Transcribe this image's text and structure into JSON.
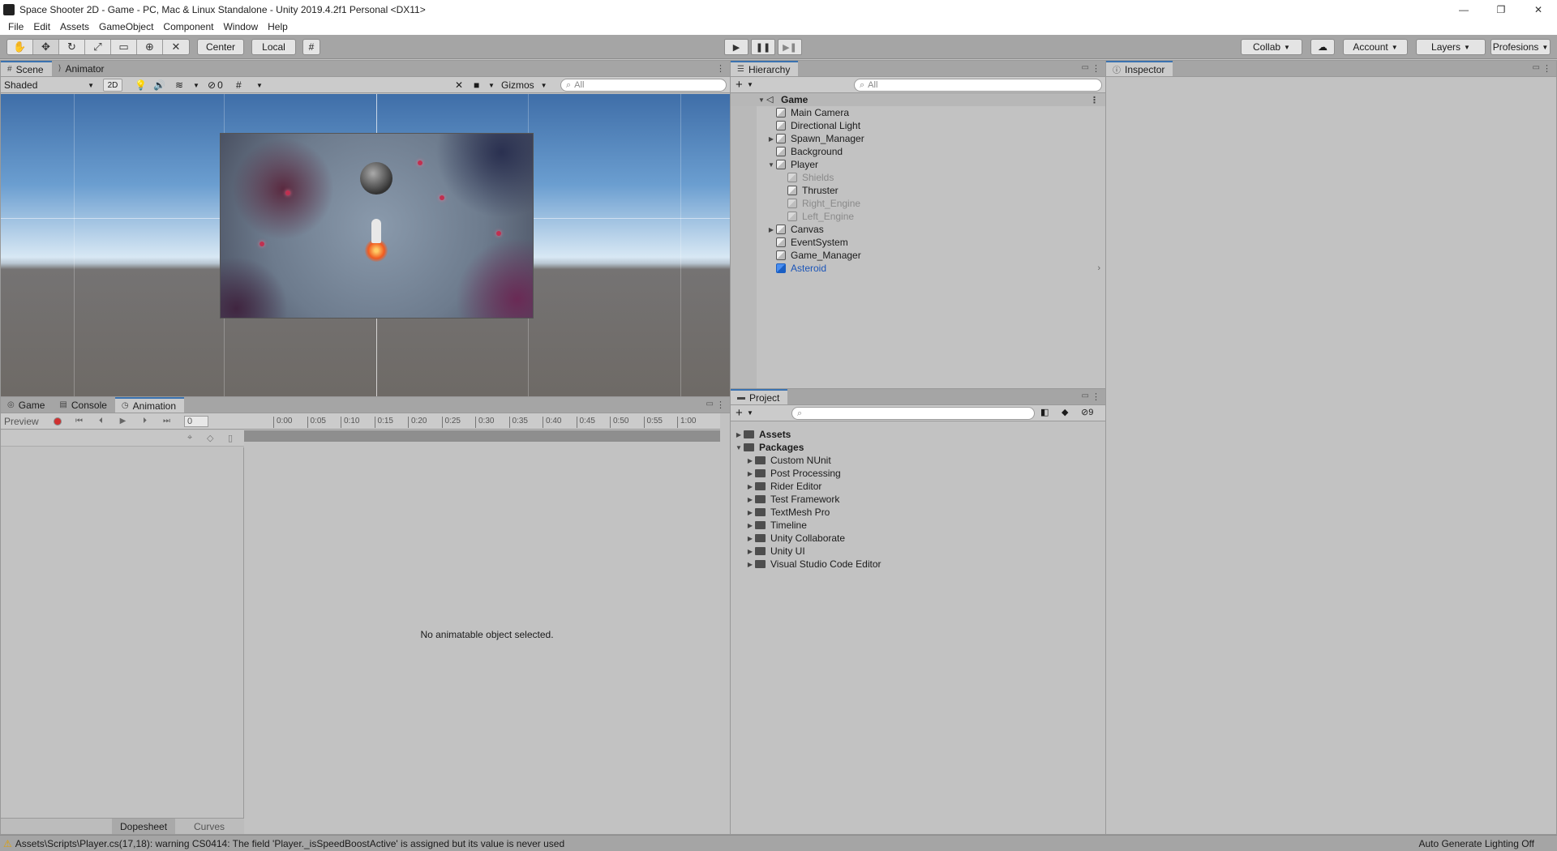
{
  "window": {
    "title": "Space Shooter 2D - Game - PC, Mac & Linux Standalone - Unity 2019.4.2f1 Personal <DX11>",
    "controls": [
      "—",
      "❐",
      "✕"
    ]
  },
  "menu": [
    "File",
    "Edit",
    "Assets",
    "GameObject",
    "Component",
    "Window",
    "Help"
  ],
  "toolbar": {
    "pivot_label": "Center",
    "space_label": "Local",
    "collab_label": "Collab",
    "account_label": "Account",
    "layers_label": "Layers",
    "layout_label": "Profesions"
  },
  "scene_panel": {
    "tabs": [
      "Scene",
      "Animator"
    ],
    "shading_mode": "Shaded",
    "mode_2d": "2D",
    "hidden_count": "0",
    "gizmos_label": "Gizmos",
    "search_placeholder": "All"
  },
  "animation_panel": {
    "tabs": [
      "Game",
      "Console",
      "Animation"
    ],
    "preview_label": "Preview",
    "frame_value": "0",
    "ruler_ticks": [
      "0:00",
      "0:05",
      "0:10",
      "0:15",
      "0:20",
      "0:25",
      "0:30",
      "0:35",
      "0:40",
      "0:45",
      "0:50",
      "0:55",
      "1:00"
    ],
    "message": "No animatable object selected.",
    "bottom_tabs": [
      "Dopesheet",
      "Curves"
    ]
  },
  "hierarchy": {
    "tab": "Hierarchy",
    "search_placeholder": "All",
    "scene_name": "Game",
    "items": [
      {
        "label": "Main Camera"
      },
      {
        "label": "Directional Light"
      },
      {
        "label": "Spawn_Manager"
      },
      {
        "label": "Background"
      },
      {
        "label": "Player"
      },
      {
        "label": "Shields"
      },
      {
        "label": "Thruster"
      },
      {
        "label": "Right_Engine"
      },
      {
        "label": "Left_Engine"
      },
      {
        "label": "Canvas"
      },
      {
        "label": "EventSystem"
      },
      {
        "label": "Game_Manager"
      },
      {
        "label": "Asteroid"
      }
    ]
  },
  "project": {
    "tab": "Project",
    "hidden_count": "9",
    "root_folders": [
      "Assets",
      "Packages"
    ],
    "packages": [
      "Custom NUnit",
      "Post Processing",
      "Rider Editor",
      "Test Framework",
      "TextMesh Pro",
      "Timeline",
      "Unity Collaborate",
      "Unity UI",
      "Visual Studio Code Editor"
    ]
  },
  "inspector": {
    "tab": "Inspector"
  },
  "statusbar": {
    "warning": "Assets\\Scripts\\Player.cs(17,18): warning CS0414: The field 'Player._isSpeedBoostActive' is assigned but its value is never used",
    "right_text": "Auto Generate Lighting Off"
  },
  "colors": {
    "accent_tab": "#3a72b0",
    "prefab_text": "#1b55b8",
    "warning_icon": "#e0a000"
  }
}
